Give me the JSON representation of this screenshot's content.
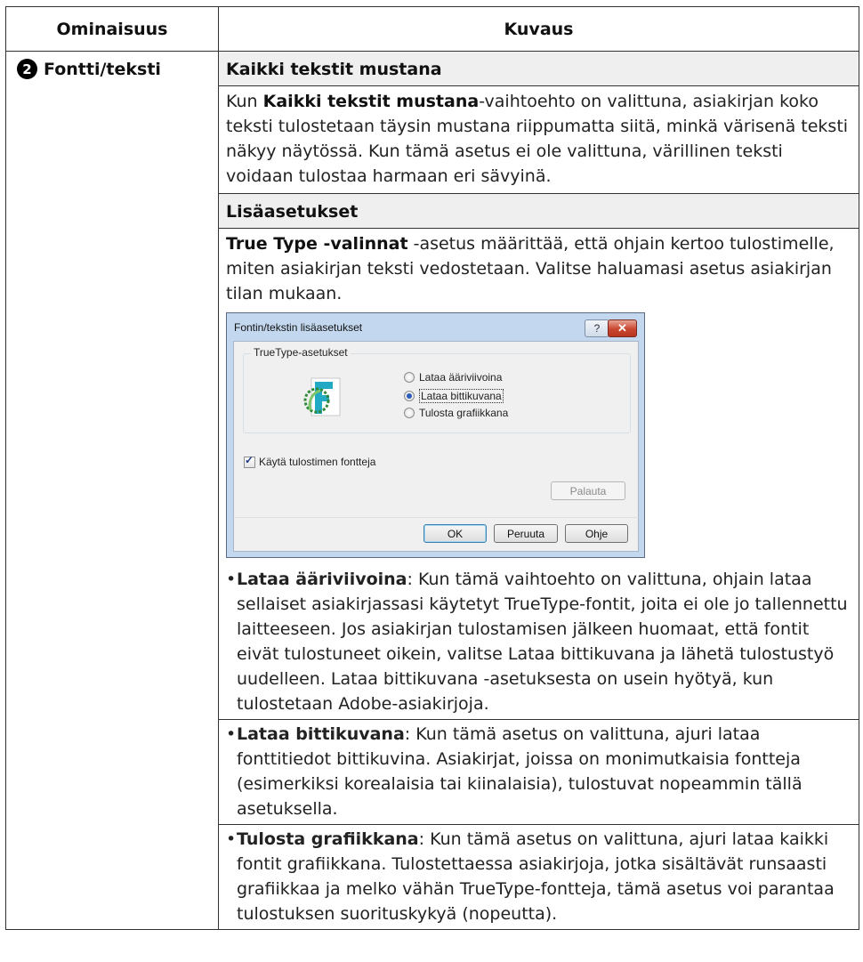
{
  "table": {
    "header": {
      "col1": "Ominaisuus",
      "col2": "Kuvaus"
    },
    "feature": {
      "number": "2",
      "label": "Fontti/teksti"
    },
    "section1": {
      "heading": "Kaikki tekstit mustana",
      "para_pre": "Kun ",
      "para_bold": "Kaikki tekstit mustana",
      "para_post": "-vaihtoehto on valittuna, asiakirjan koko teksti tulostetaan täysin mustana riippumatta siitä, minkä värisenä teksti näkyy näytössä. Kun tämä asetus ei ole valittuna, värillinen teksti voidaan tulostaa harmaan eri sävyinä."
    },
    "section2": {
      "heading": "Lisäasetukset",
      "para_bold": "True Type -valinnat",
      "para_post": " -asetus määrittää, että ohjain kertoo tulostimelle, miten asiakirjan teksti vedostetaan. Valitse haluamasi asetus asiakirjan tilan mukaan."
    },
    "bullets": [
      {
        "term": "Lataa ääriviivoina",
        "text": ": Kun tämä vaihtoehto on valittuna, ohjain lataa sellaiset asiakirjassasi käytetyt TrueType-fontit, joita ei ole jo tallennettu laitteeseen. Jos asiakirjan tulostamisen jälkeen huomaat, että fontit eivät tulostuneet oikein, valitse Lataa bittikuvana ja lähetä tulostustyö uudelleen. Lataa bittikuvana -asetuksesta on usein hyötyä, kun tulostetaan Adobe-asiakirjoja."
      },
      {
        "term": "Lataa bittikuvana",
        "text": ": Kun tämä asetus on valittuna, ajuri lataa fonttitiedot bittikuvina. Asiakirjat, joissa on monimutkaisia fontteja (esimerkiksi korealaisia tai kiinalaisia), tulostuvat nopeammin tällä asetuksella."
      },
      {
        "term": "Tulosta grafiikkana",
        "text": ": Kun tämä asetus on valittuna, ajuri lataa kaikki fontit grafiikkana. Tulostettaessa asiakirjoja, jotka sisältävät runsaasti grafiikkaa ja melko vähän TrueType-fontteja, tämä asetus voi parantaa tulostuksen suorituskykyä (nopeutta)."
      }
    ]
  },
  "dialog": {
    "title": "Fontin/tekstin lisäasetukset",
    "help_label": "?",
    "close_label": "✕",
    "group_label": "TrueType-asetukset",
    "radio_options": [
      "Lataa ääriviivoina",
      "Lataa bittikuvana",
      "Tulosta grafiikkana"
    ],
    "selected_option": "Lataa bittikuvana",
    "checkbox_label": "Käytä tulostimen fontteja",
    "checkbox_checked": true,
    "reset_label": "Palauta",
    "ok_label": "OK",
    "cancel_label": "Peruuta",
    "help_button_label": "Ohje"
  }
}
